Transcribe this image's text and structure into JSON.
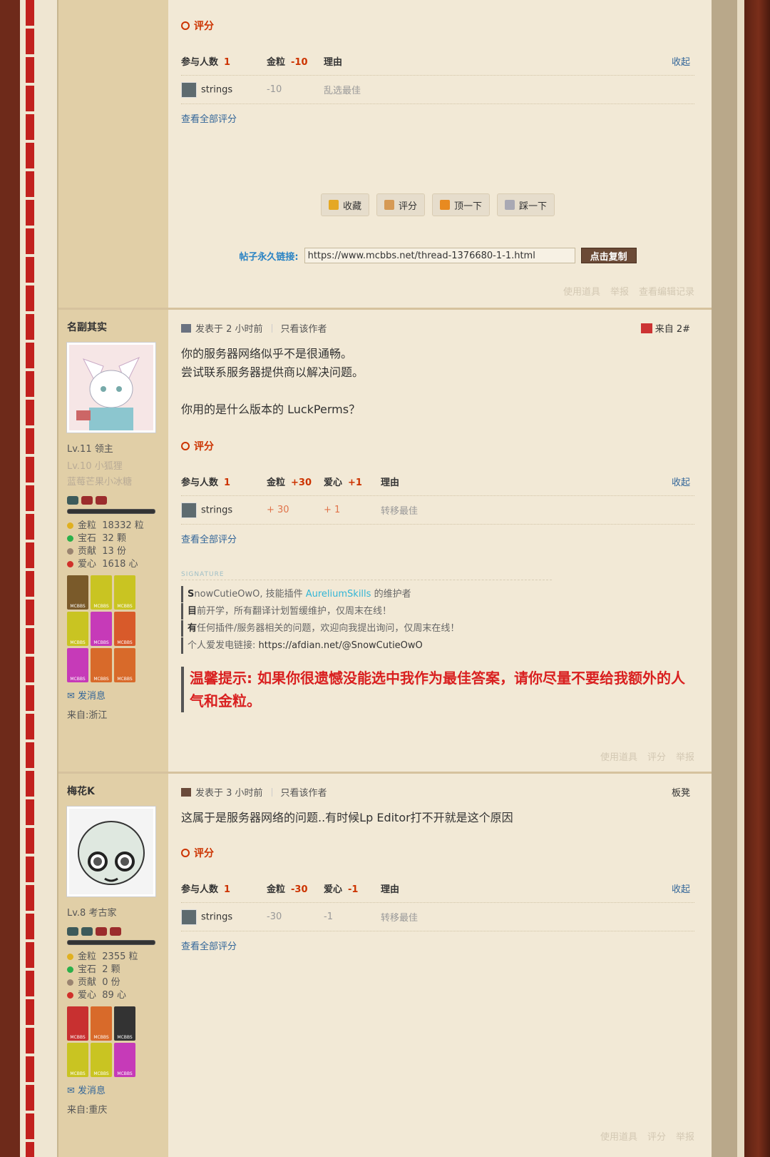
{
  "post1": {
    "rate_title": "评分",
    "rate_header": {
      "participants_label": "参与人数",
      "participants": "1",
      "col1_label": "金粒",
      "col1_value": "-10",
      "reason_label": "理由",
      "collapse": "收起"
    },
    "rate_rows": [
      {
        "user": "strings",
        "v1": "-10",
        "reason": "乱选最佳"
      }
    ],
    "view_all": "查看全部评分",
    "actions": [
      "收藏",
      "评分",
      "顶一下",
      "踩一下"
    ],
    "permalink_label": "帖子永久链接:",
    "permalink_url": "https://www.mcbbs.net/thread-1376680-1-1.html",
    "copy_button": "点击复制",
    "faint_links": [
      "使用道具",
      "举报",
      "查看编辑记录"
    ]
  },
  "post2": {
    "author": "名副其实",
    "level": "Lv.11 领主",
    "sub_levels": [
      "Lv.10 小狐狸",
      "蓝莓芒果小冰糖"
    ],
    "stats": [
      {
        "label": "金粒",
        "value": "18332 粒",
        "color": "#e0b020"
      },
      {
        "label": "宝石",
        "value": "32 颗",
        "color": "#2bb04a"
      },
      {
        "label": "贡献",
        "value": "13 份",
        "color": "#9a8470"
      },
      {
        "label": "爱心",
        "value": "1618 心",
        "color": "#d0302a"
      }
    ],
    "send_msg": "发消息",
    "from": "来自:浙江",
    "meta_posted": "发表于 2 小时前",
    "meta_author_only": "只看该作者",
    "floor": "来自 2#",
    "lines": [
      "你的服务器网络似乎不是很通畅。",
      "尝试联系服务器提供商以解决问题。",
      "",
      "你用的是什么版本的 LuckPerms？"
    ],
    "rate_title": "评分",
    "rate_header": {
      "participants_label": "参与人数",
      "participants": "1",
      "col1_label": "金粒",
      "col1_value": "+30",
      "col2_label": "爱心",
      "col2_value": "+1",
      "reason_label": "理由",
      "collapse": "收起"
    },
    "rate_rows": [
      {
        "user": "strings",
        "v1": "+ 30",
        "v2": "+ 1",
        "reason": "转移最佳"
      }
    ],
    "view_all": "查看全部评分",
    "signature_label": "SIGNATURE",
    "sig": {
      "l1_a": "S",
      "l1_b": "nowCutieOwO, 技能插件 ",
      "l1_link": "AureliumSkills",
      "l1_c": " 的维护者",
      "l2_a": "目",
      "l2_b": "前开学，所有翻译计划暂缓维护，仅周末在线！",
      "l3_a": "有",
      "l3_b": "任何插件/服务器相关的问题，欢迎向我提出询问，仅周末在线！",
      "l4_a": "个人爱发电链接: ",
      "l4_url": "https://afdian.net/@SnowCutieOwO"
    },
    "warm_tip": "温馨提示: 如果你很遗憾没能选中我作为最佳答案，请你尽量不要给我额外的人气和金粒。",
    "faint_links": [
      "使用道具",
      "评分",
      "举报"
    ]
  },
  "post3": {
    "author": "梅花K",
    "level": "Lv.8 考古家",
    "stats": [
      {
        "label": "金粒",
        "value": "2355 粒",
        "color": "#e0b020"
      },
      {
        "label": "宝石",
        "value": "2 颗",
        "color": "#2bb04a"
      },
      {
        "label": "贡献",
        "value": "0 份",
        "color": "#9a8470"
      },
      {
        "label": "爱心",
        "value": "89 心",
        "color": "#d0302a"
      }
    ],
    "send_msg": "发消息",
    "from": "来自:重庆",
    "meta_posted": "发表于 3 小时前",
    "meta_author_only": "只看该作者",
    "floor": "板凳",
    "text": "这属于是服务器网络的问题..有时候Lp Editor打不开就是这个原因",
    "rate_title": "评分",
    "rate_header": {
      "participants_label": "参与人数",
      "participants": "1",
      "col1_label": "金粒",
      "col1_value": "-30",
      "col2_label": "爱心",
      "col2_value": "-1",
      "reason_label": "理由",
      "collapse": "收起"
    },
    "rate_rows": [
      {
        "user": "strings",
        "v1": "-30",
        "v2": "-1",
        "reason": "转移最佳"
      }
    ],
    "view_all": "查看全部评分",
    "faint_links": [
      "使用道具",
      "评分",
      "举报"
    ]
  }
}
